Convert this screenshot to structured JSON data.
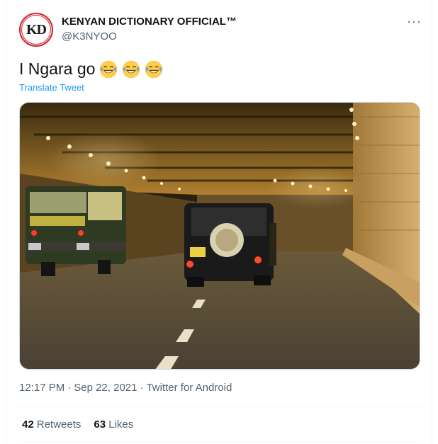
{
  "tweet": {
    "avatar_text": "KD",
    "display_name": "KENYAN DICTIONARY OFFICIAL™",
    "handle": "@K3NYOO",
    "more_label": "···",
    "text": "I Ngara go",
    "emojis": [
      "face-with-tears-of-joy-icon",
      "face-with-tears-of-joy-icon",
      "face-with-tears-of-joy-icon"
    ],
    "translate_label": "Translate Tweet",
    "time": "12:17 PM",
    "separator": "·",
    "date": "Sep 22, 2021",
    "source": "Twitter for Android",
    "retweets_count": "42",
    "retweets_label": "Retweets",
    "likes_count": "63",
    "likes_label": "Likes"
  },
  "media": {
    "description_icon": "photo-icon"
  },
  "colors": {
    "link": "#1d9bf0",
    "secondary_text": "#536471",
    "primary_text": "#0f1419",
    "avatar_ring": "#d2232a"
  }
}
